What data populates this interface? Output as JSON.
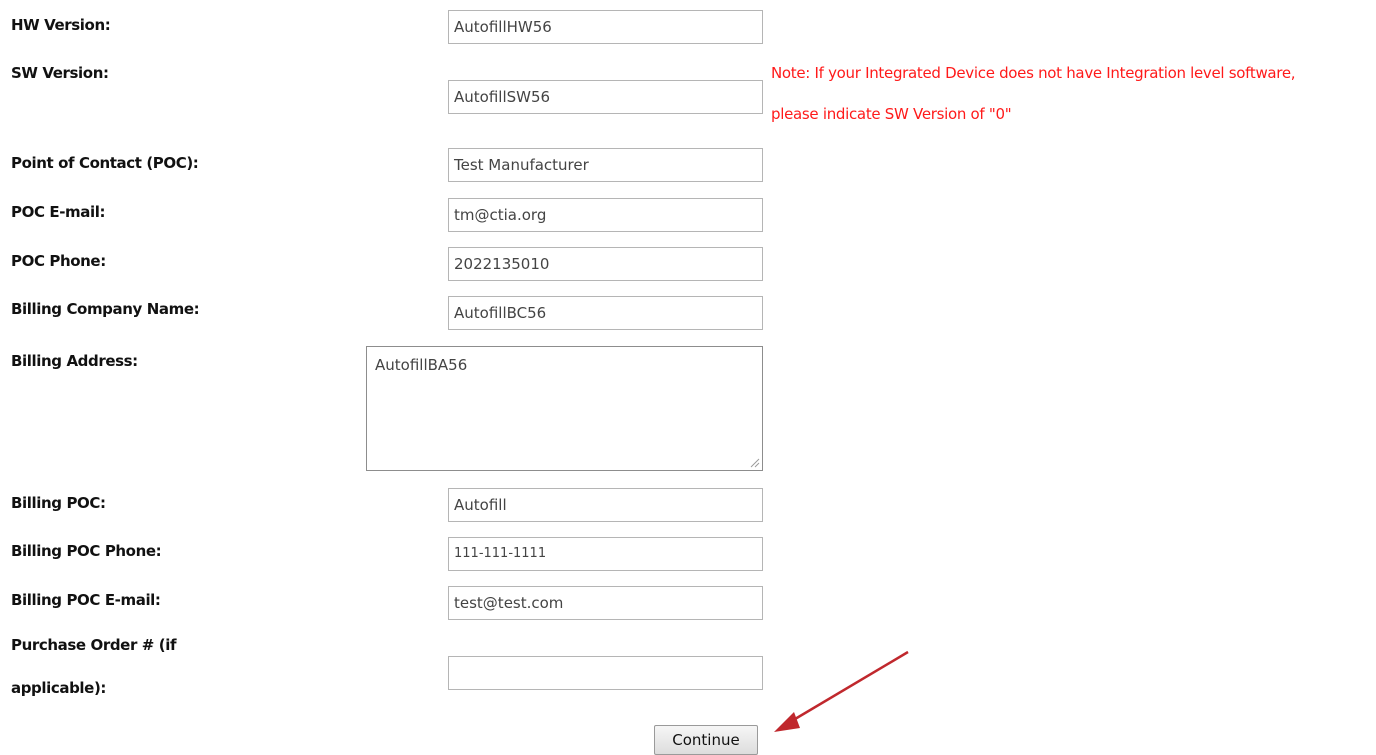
{
  "form": {
    "hw_version": {
      "label": "HW Version:",
      "value": "AutofillHW56"
    },
    "sw_version": {
      "label": "SW Version:",
      "value": "AutofillSW56"
    },
    "sw_note": {
      "line1": "Note: If your Integrated Device does not have Integration level software,",
      "line2": "please indicate SW Version of \"0\""
    },
    "poc": {
      "label": "Point of Contact (POC):",
      "value": "Test Manufacturer"
    },
    "poc_email": {
      "label": "POC E-mail:",
      "value": "tm@ctia.org"
    },
    "poc_phone": {
      "label": "POC Phone:",
      "value": "2022135010"
    },
    "billing_company": {
      "label": "Billing Company Name:",
      "value": "AutofillBC56"
    },
    "billing_address": {
      "label": "Billing Address:",
      "value": "AutofillBA56"
    },
    "billing_poc": {
      "label": "Billing POC:",
      "value": "Autofill"
    },
    "billing_poc_phone": {
      "label": "Billing POC Phone:",
      "value": "111-111-1111"
    },
    "billing_poc_email": {
      "label": "Billing POC E-mail:",
      "value": "test@test.com"
    },
    "purchase_order": {
      "label_line1": "Purchase Order # (if",
      "label_line2": "applicable):",
      "value": ""
    },
    "continue_label": "Continue"
  },
  "colors": {
    "note_text": "#ff1a1a",
    "arrow": "#c0282d"
  },
  "annotation_icon": "red-arrow-icon"
}
